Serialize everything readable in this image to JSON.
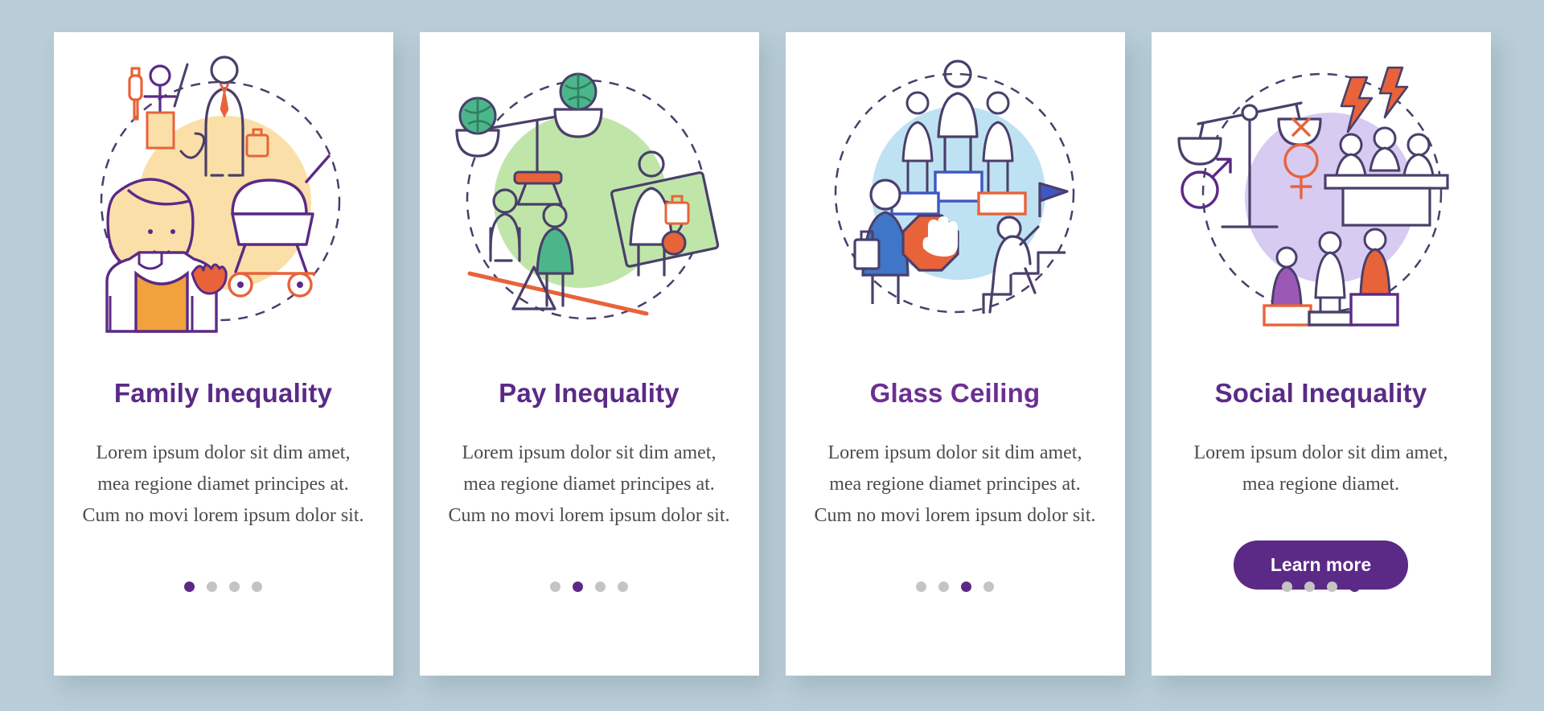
{
  "page": {
    "background_color": "#b8cdd7",
    "card_background": "#ffffff",
    "accent_color": "#5b2a86",
    "dot_inactive_color": "#c4c4c4"
  },
  "cards": [
    {
      "id": "family-inequality",
      "title": "Family Inequality",
      "body": "Lorem ipsum dolor sit dim amet, mea regione diamet principes at. Cum no movi lorem ipsum dolor sit.",
      "dots": 4,
      "active_dot": 0,
      "illustration": "family-inequality-illustration",
      "button": null
    },
    {
      "id": "pay-inequality",
      "title": "Pay Inequality",
      "body": "Lorem ipsum dolor sit dim amet, mea regione diamet principes at. Cum no movi lorem ipsum dolor sit.",
      "dots": 4,
      "active_dot": 1,
      "illustration": "pay-inequality-illustration",
      "button": null
    },
    {
      "id": "glass-ceiling",
      "title": "Glass Ceiling",
      "body": "Lorem ipsum dolor sit dim amet, mea regione diamet principes at. Cum no movi lorem ipsum dolor sit.",
      "dots": 4,
      "active_dot": 2,
      "illustration": "glass-ceiling-illustration",
      "button": null
    },
    {
      "id": "social-inequality",
      "title": "Social Inequality",
      "body": "Lorem ipsum dolor sit dim amet, mea regione diamet.",
      "dots": 4,
      "active_dot": 3,
      "illustration": "social-inequality-illustration",
      "button": "Learn more"
    }
  ]
}
